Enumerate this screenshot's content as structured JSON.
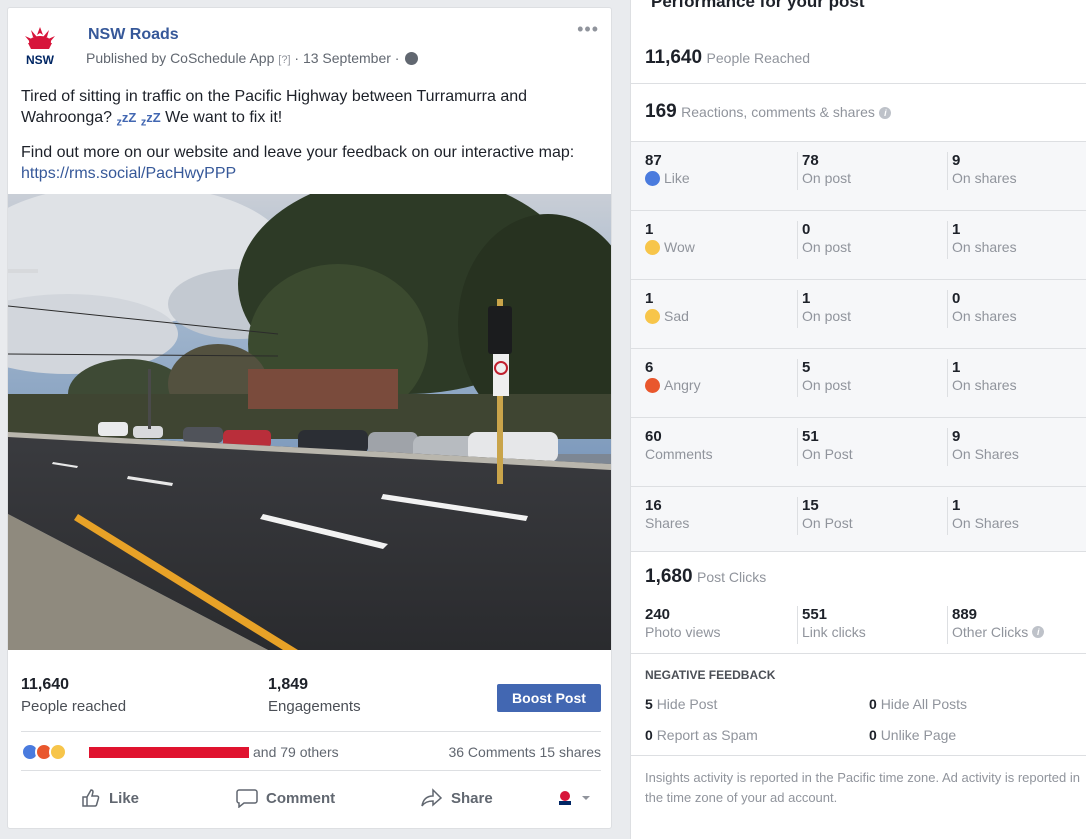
{
  "post": {
    "page_name": "NSW Roads",
    "logo_text": "NSW",
    "published_prefix": "Published by",
    "published_app": "CoSchedule App",
    "published_q": "[?]",
    "published_date": "· 13 September ·",
    "more": "•••",
    "text_line1_a": "Tired of sitting in traffic on the Pacific Highway between Turramurra and Wahroonga?",
    "text_line1_b": "We want to fix it!",
    "zz": "zZ",
    "text_line2_a": "Find out more on our website and leave your feedback on our interactive map:",
    "link": "https://rms.social/PacHwyPPP",
    "reached_num": "11,640",
    "reached_lbl": "People reached",
    "engage_num": "1,849",
    "engage_lbl": "Engagements",
    "boost_label": "Boost Post",
    "others": "and 79 others",
    "comments_shares": "36 Comments  15 shares",
    "action_like": "Like",
    "action_comment": "Comment",
    "action_share": "Share",
    "colors": {
      "link": "#365899",
      "boost": "#4267b2",
      "redact": "#e0132f"
    }
  },
  "insights": {
    "title": "Performance for your post",
    "reached_num": "11,640",
    "reached_lbl": "People Reached",
    "reactions_num": "169",
    "reactions_lbl": "Reactions, comments & shares",
    "rows": [
      {
        "total": "87",
        "label": "Like",
        "post": "78",
        "post_lbl": "On post",
        "shares": "9",
        "shares_lbl": "On shares"
      },
      {
        "total": "1",
        "label": "Wow",
        "post": "0",
        "post_lbl": "On post",
        "shares": "1",
        "shares_lbl": "On shares"
      },
      {
        "total": "1",
        "label": "Sad",
        "post": "1",
        "post_lbl": "On post",
        "shares": "0",
        "shares_lbl": "On shares"
      },
      {
        "total": "6",
        "label": "Angry",
        "post": "5",
        "post_lbl": "On post",
        "shares": "1",
        "shares_lbl": "On shares"
      },
      {
        "total": "60",
        "label": "Comments",
        "post": "51",
        "post_lbl": "On Post",
        "shares": "9",
        "shares_lbl": "On Shares"
      },
      {
        "total": "16",
        "label": "Shares",
        "post": "15",
        "post_lbl": "On Post",
        "shares": "1",
        "shares_lbl": "On Shares"
      }
    ],
    "clicks_num": "1,680",
    "clicks_lbl": "Post Clicks",
    "clicks": [
      {
        "n": "240",
        "l": "Photo views"
      },
      {
        "n": "551",
        "l": "Link clicks"
      },
      {
        "n": "889",
        "l": "Other Clicks"
      }
    ],
    "neg_title": "NEGATIVE FEEDBACK",
    "neg": [
      {
        "n": "5",
        "l": "Hide Post"
      },
      {
        "n": "0",
        "l": "Hide All Posts"
      },
      {
        "n": "0",
        "l": "Report as Spam"
      },
      {
        "n": "0",
        "l": "Unlike Page"
      }
    ],
    "footer": "Insights activity is reported in the Pacific time zone. Ad activity is reported in the time zone of your ad account."
  }
}
